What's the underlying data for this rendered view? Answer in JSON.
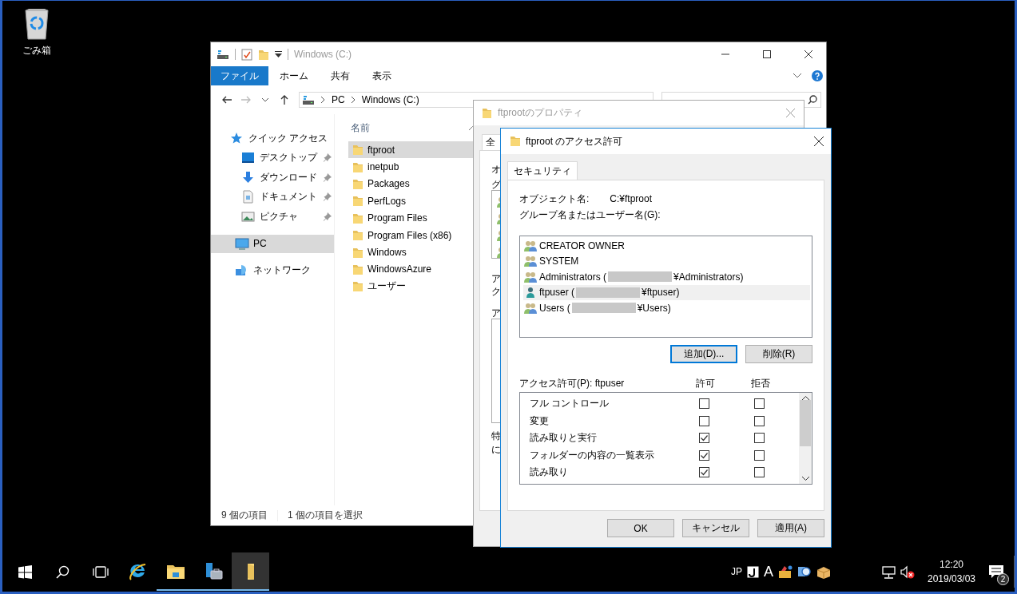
{
  "desktop": {
    "icons": [
      {
        "label": "ごみ箱",
        "kind": "recycle-bin"
      }
    ]
  },
  "explorer": {
    "title": "Windows (C:)",
    "ribbon_tabs": [
      {
        "label": "ファイル",
        "selected": true
      },
      {
        "label": "ホーム",
        "selected": false
      },
      {
        "label": "共有",
        "selected": false
      },
      {
        "label": "表示",
        "selected": false
      }
    ],
    "address": [
      "PC",
      "Windows (C:)"
    ],
    "nav": [
      {
        "label": "クイック アクセス",
        "kind": "star",
        "selected": false,
        "children": [
          {
            "label": "デスクトップ",
            "kind": "desktop",
            "pinned": true,
            "selected": false
          },
          {
            "label": "ダウンロード",
            "kind": "download",
            "pinned": true,
            "selected": false
          },
          {
            "label": "ドキュメント",
            "kind": "document",
            "pinned": true,
            "selected": false
          },
          {
            "label": "ピクチャ",
            "kind": "pictures",
            "pinned": true,
            "selected": false
          }
        ]
      },
      {
        "label": "PC",
        "kind": "pc",
        "selected": true
      },
      {
        "label": "ネットワーク",
        "kind": "network",
        "selected": false
      }
    ],
    "column_header": "名前",
    "files": [
      {
        "name": "ftproot",
        "selected": true
      },
      {
        "name": "inetpub",
        "selected": false
      },
      {
        "name": "Packages",
        "selected": false
      },
      {
        "name": "PerfLogs",
        "selected": false
      },
      {
        "name": "Program Files",
        "selected": false
      },
      {
        "name": "Program Files (x86)",
        "selected": false
      },
      {
        "name": "Windows",
        "selected": false
      },
      {
        "name": "WindowsAzure",
        "selected": false
      },
      {
        "name": "ユーザー",
        "selected": false
      }
    ],
    "status": [
      "9 個の項目",
      "1 個の項目を選択"
    ]
  },
  "properties_dialog": {
    "title": "ftprootのプロパティ",
    "tab": "全",
    "fragments": [
      "オ",
      "グ",
      "ア",
      "ク",
      "ア",
      "特",
      "に"
    ]
  },
  "permissions_dialog": {
    "title": "ftproot のアクセス許可",
    "tabs": [
      {
        "label": "セキュリティ",
        "selected": true
      }
    ],
    "object_label": "オブジェクト名:",
    "object_value": "C:¥ftproot",
    "users_label": "グループ名またはユーザー名(G):",
    "users": [
      {
        "name": "CREATOR OWNER",
        "kind": "group",
        "redacted": false,
        "selected": false
      },
      {
        "name": "SYSTEM",
        "kind": "group",
        "redacted": false,
        "selected": false
      },
      {
        "name": "Administrators (",
        "suffix": "¥Administrators)",
        "kind": "group",
        "redacted": true,
        "selected": false
      },
      {
        "name": "ftpuser (",
        "suffix": "¥ftpuser)",
        "kind": "user",
        "redacted": true,
        "selected": true
      },
      {
        "name": "Users (",
        "suffix": "¥Users)",
        "kind": "group",
        "redacted": true,
        "selected": false
      }
    ],
    "user_buttons": [
      {
        "label": "追加(D)...",
        "focused": true
      },
      {
        "label": "削除(R)",
        "focused": false
      }
    ],
    "permissions_label": "アクセス許可(P): ftpuser",
    "columns": [
      "許可",
      "拒否"
    ],
    "permissions": [
      {
        "name": "フル コントロール",
        "allow": false,
        "deny": false
      },
      {
        "name": "変更",
        "allow": false,
        "deny": false
      },
      {
        "name": "読み取りと実行",
        "allow": true,
        "deny": false
      },
      {
        "name": "フォルダーの内容の一覧表示",
        "allow": true,
        "deny": false
      },
      {
        "name": "読み取り",
        "allow": true,
        "deny": false
      }
    ],
    "buttons": [
      "OK",
      "キャンセル",
      "適用(A)"
    ]
  },
  "taskbar": {
    "apps": [
      {
        "kind": "ie",
        "running": false,
        "active": false
      },
      {
        "kind": "explorer",
        "running": true,
        "active": false
      },
      {
        "kind": "server-manager",
        "running": true,
        "active": false
      },
      {
        "kind": "folder",
        "running": true,
        "active": true
      }
    ],
    "ime": "JP",
    "ime_mode": "A",
    "clock": {
      "time": "12:20",
      "date": "2019/03/03"
    },
    "notifications": "2"
  }
}
